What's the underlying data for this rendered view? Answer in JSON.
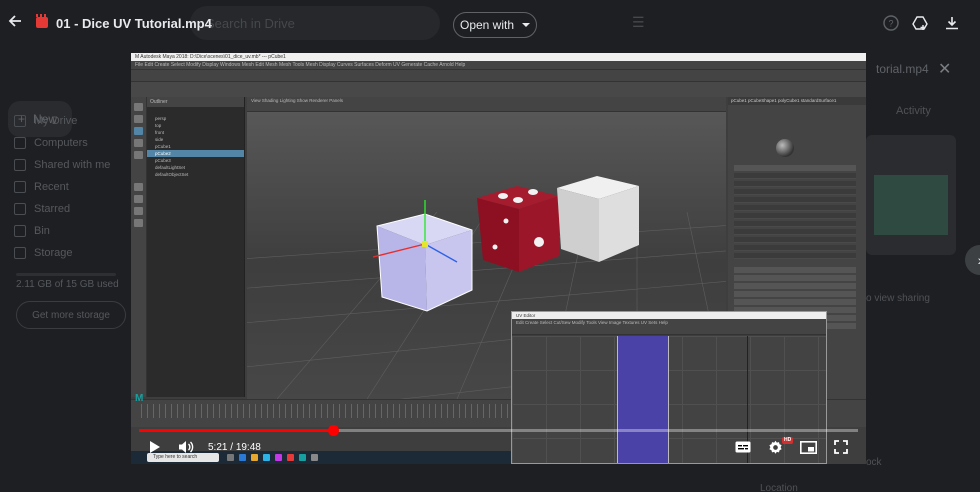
{
  "viewer": {
    "file_title": "01 - Dice UV Tutorial.mp4",
    "open_with_label": "Open with",
    "back_icon": "arrow-left-icon",
    "colors": {
      "accent_red": "#ff0000",
      "file_icon": "#e53935",
      "bg": "#202124"
    }
  },
  "background_drive": {
    "search_placeholder": "Search in Drive",
    "new_label": "New",
    "sidebar": [
      {
        "label": "My Drive"
      },
      {
        "label": "Computers"
      },
      {
        "label": "Shared with me"
      },
      {
        "label": "Recent"
      },
      {
        "label": "Starred"
      },
      {
        "label": "Bin"
      },
      {
        "label": "Storage"
      }
    ],
    "storage_text": "2.11 GB of 15 GB used",
    "get_storage_label": "Get more storage",
    "details_title": "torial.mp4",
    "activity_label": "Activity",
    "sharing_label": "o view sharing",
    "lock_label": "ock",
    "location_label": "Location"
  },
  "maya": {
    "title_text": "M Autodesk Maya 2018: D:\\Dice\\scenes\\01_dice_uv.mb* --- pCube1",
    "menu_text": "File  Edit  Create  Select  Modify  Display  Windows  Mesh  Edit Mesh  Mesh Tools  Mesh Display  Curves  Surfaces  Deform  UV  Generate  Cache  Arnold  Help",
    "outliner_title": "Outliner",
    "outliner_rows": [
      "persp",
      "top",
      "front",
      "side",
      "pCube1",
      "pCube2",
      "pCube3",
      "defaultLightSet",
      "defaultObjectSet"
    ],
    "viewport_menu": "View  Shading  Lighting  Show  Renderer  Panels",
    "attr_tabs": "pCube1  pCubeShape1  polyCube1  standardSurface1",
    "uv_title": "UV Editor",
    "uv_menu": "Edit  Create  Select  Cut/Sew  Modify  Tools  View  Image  Textures  UV Sets  Help",
    "taskbar_search": "Type here to search",
    "logo": "M"
  },
  "player": {
    "current_time": "5:21",
    "duration": "19:48",
    "time_sep": " / ",
    "progress_fraction": 0.27,
    "buttons": {
      "play": "play-icon",
      "volume": "volume-icon",
      "captions": "captions-icon",
      "settings": "settings-icon",
      "miniplayer": "miniplayer-icon",
      "fullscreen": "fullscreen-icon"
    },
    "hd_badge": "HD"
  }
}
